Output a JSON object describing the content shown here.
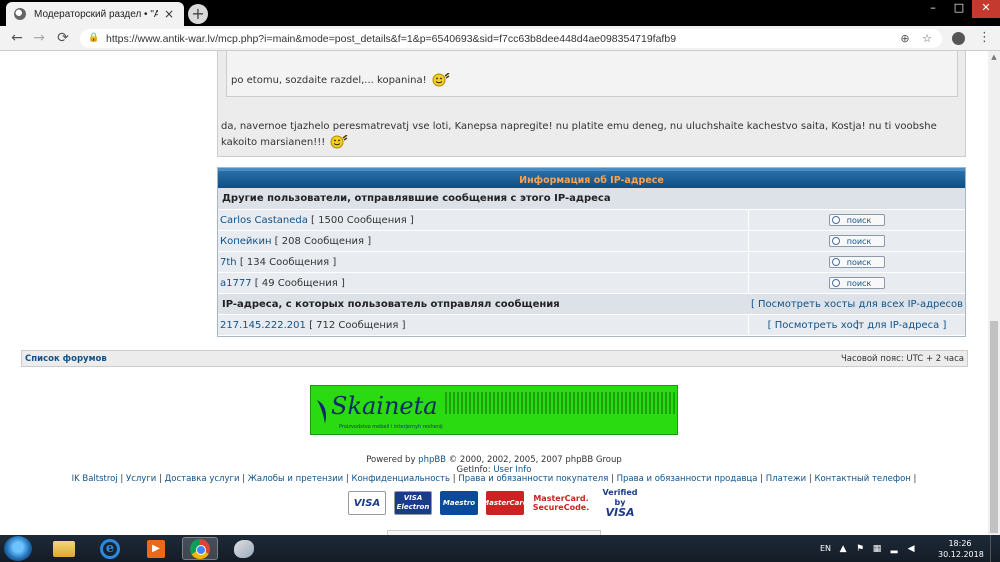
{
  "browser": {
    "tab_title": "Модераторский раздел • \"ANTIK",
    "tab_close": "×",
    "new_tab": "+",
    "window_controls": {
      "minimize": "–",
      "maximize": "□",
      "close": "✕"
    },
    "url": "https://www.antik-war.lv/mcp.php?i=main&mode=post_details&f=1&p=6540693&sid=f7cc63b8dee448d4ae098354719fafb9",
    "nav": {
      "back": "←",
      "forward": "→",
      "reload": "⟳"
    },
    "icons": {
      "lock": "lock-icon",
      "zoom": "zoom-icon",
      "bookmark": "star-icon"
    }
  },
  "post": {
    "quote_text": "po etomu, sozdaite razdel,... kopanina!",
    "body_text": "da, navernoe tjazhelo peresmatrevatj vse loti, Kanepsa napregite! nu platite emu deneg, nu uluchshaite kachestvo saita, Kostja! nu ti voobshe kakoito marsianen!!!"
  },
  "ip_info": {
    "title": "Информация об IP-адресе",
    "other_users_header": "Другие пользователи, отправлявшие сообщения с этого IP-адреса",
    "search_label": "поиск",
    "users": [
      {
        "name": "Carlos Castaneda",
        "count": "[ 1500 Сообщения ]"
      },
      {
        "name": "Копейкин",
        "count": "[ 208 Сообщения ]"
      },
      {
        "name": "7th",
        "count": "[ 134 Сообщения ]"
      },
      {
        "name": "a1777",
        "count": "[ 49 Сообщения ]"
      }
    ],
    "ip_header": "IP-адреса, с которых пользователь отправлял сообщения",
    "view_all_hosts": "[ Посмотреть хосты для всех IP-адресов ]",
    "ips": [
      {
        "ip": "217.145.222.201",
        "count": "[ 712 Сообщения ]",
        "host_link": "[ Посмотреть хост для IP-адреса ]"
      }
    ]
  },
  "footer": {
    "forum_index": "Список форумов",
    "timezone": "Часовой пояс: UTC + 2 часа",
    "banner_logo": "Skaineta",
    "banner_tagline": "Proizvodstvo mebeli i interjernyh reshenij",
    "powered_prefix": "Powered by",
    "powered_link": "phpBB",
    "powered_suffix": "© 2000, 2002, 2005, 2007 phpBB Group",
    "getinfo_prefix": "GetInfo:",
    "getinfo_link": "User Info",
    "links": [
      "IK Baltstroj",
      "Услуги",
      "Доставка услуги",
      "Жалобы и претензии",
      "Конфиденциальность",
      "Права и обязанности покупателя",
      "Права и обязанности продавца",
      "Платежи",
      "Контактный телефон"
    ],
    "cards": {
      "visa": "VISA",
      "visa_electron_top": "VISA",
      "visa_electron_bottom": "Electron",
      "maestro": "Maestro",
      "mastercard": "MasterCard",
      "mc_securecode_top": "MasterCard.",
      "mc_securecode_bottom": "SecureCode.",
      "vbv_top": "Verified by",
      "vbv_bottom": "VISA"
    }
  },
  "taskbar": {
    "language": "EN",
    "time": "18:26",
    "date": "30.12.2018"
  }
}
